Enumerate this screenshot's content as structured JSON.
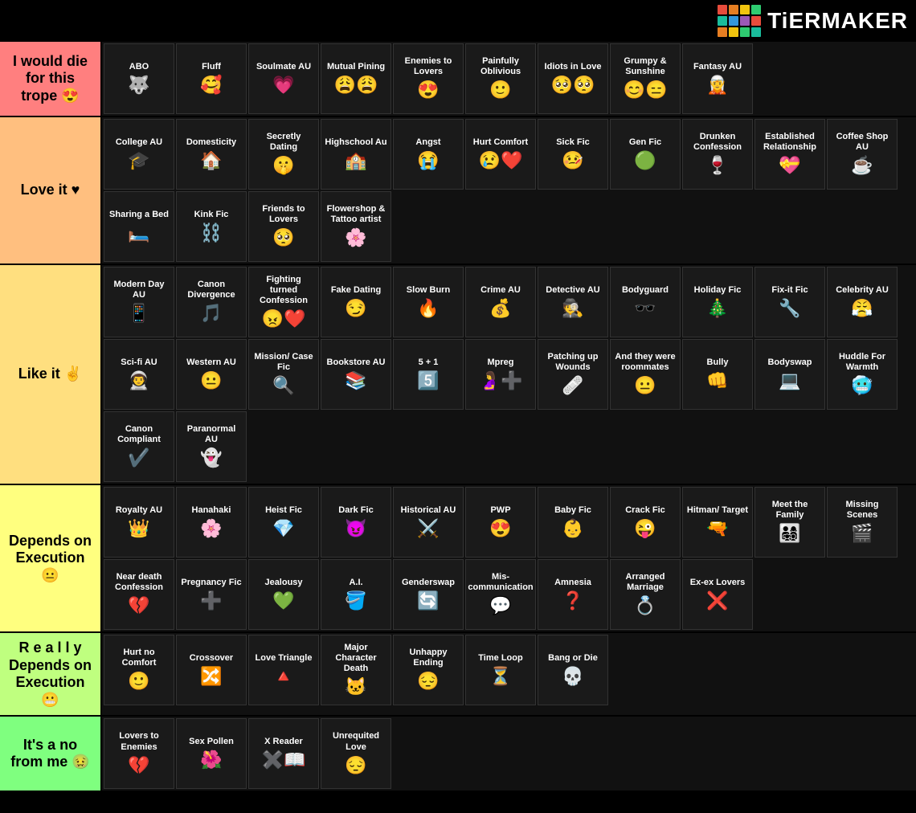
{
  "logo": {
    "colors": [
      "#e74c3c",
      "#e67e22",
      "#f1c40f",
      "#2ecc71",
      "#1abc9c",
      "#3498db",
      "#9b59b6",
      "#e74c3c",
      "#e67e22",
      "#f1c40f",
      "#2ecc71",
      "#1abc9c"
    ],
    "text": "TiERMAKER"
  },
  "tiers": [
    {
      "id": "s",
      "label": "I would die for this trope 😍",
      "color": "#ff7f7f",
      "cards": [
        {
          "title": "ABO",
          "emoji": "🐺"
        },
        {
          "title": "Fluff",
          "emoji": "🥰"
        },
        {
          "title": "Soulmate AU",
          "emoji": "💗"
        },
        {
          "title": "Mutual Pining",
          "emoji": "😩😩"
        },
        {
          "title": "Enemies to Lovers",
          "emoji": "😍"
        },
        {
          "title": "Painfully Oblivious",
          "emoji": "🙂"
        },
        {
          "title": "Idiots in Love",
          "emoji": "🥺🥺"
        },
        {
          "title": "Grumpy & Sunshine",
          "emoji": "😊😑"
        },
        {
          "title": "Fantasy AU",
          "emoji": "🧝"
        }
      ]
    },
    {
      "id": "a",
      "label": "Love it ♥",
      "color": "#ffbf7f",
      "cards": [
        {
          "title": "College AU",
          "emoji": "🎓"
        },
        {
          "title": "Domesticity",
          "emoji": "🏠"
        },
        {
          "title": "Secretly Dating",
          "emoji": "🤫"
        },
        {
          "title": "Highschool Au",
          "emoji": "🏫"
        },
        {
          "title": "Angst",
          "emoji": "😭"
        },
        {
          "title": "Hurt Comfort",
          "emoji": "😢❤️"
        },
        {
          "title": "Sick Fic",
          "emoji": "🤒"
        },
        {
          "title": "Gen Fic",
          "emoji": "🟢"
        },
        {
          "title": "Drunken Confession",
          "emoji": "🍷"
        },
        {
          "title": "Established Relationship",
          "emoji": "💝"
        },
        {
          "title": "Coffee Shop AU",
          "emoji": "☕"
        },
        {
          "title": "Sharing a Bed",
          "emoji": "🛏️"
        },
        {
          "title": "Kink Fic",
          "emoji": "⛓️"
        },
        {
          "title": "Friends to Lovers",
          "emoji": "🥺"
        },
        {
          "title": "Flowershop & Tattoo artist",
          "emoji": "🌸"
        }
      ]
    },
    {
      "id": "b",
      "label": "Like it ✌",
      "color": "#ffdf7f",
      "cards": [
        {
          "title": "Modern Day AU",
          "emoji": "📱"
        },
        {
          "title": "Canon Divergence",
          "emoji": "🎵"
        },
        {
          "title": "Fighting turned Confession",
          "emoji": "😠❤️"
        },
        {
          "title": "Fake Dating",
          "emoji": "😏"
        },
        {
          "title": "Slow Burn",
          "emoji": "🔥"
        },
        {
          "title": "Crime AU",
          "emoji": "💰"
        },
        {
          "title": "Detective AU",
          "emoji": "🕵️"
        },
        {
          "title": "Bodyguard",
          "emoji": "🕶️"
        },
        {
          "title": "Holiday Fic",
          "emoji": "🎄"
        },
        {
          "title": "Fix-it Fic",
          "emoji": "🔧"
        },
        {
          "title": "Celebrity AU",
          "emoji": "😤"
        },
        {
          "title": "Sci-fi AU",
          "emoji": "👨‍🚀"
        },
        {
          "title": "Western AU",
          "emoji": "😐"
        },
        {
          "title": "Mission/ Case Fic",
          "emoji": "🔍"
        },
        {
          "title": "Bookstore AU",
          "emoji": "📚"
        },
        {
          "title": "5 + 1",
          "emoji": "5️⃣"
        },
        {
          "title": "Mpreg",
          "emoji": "🤰➕"
        },
        {
          "title": "Patching up Wounds",
          "emoji": "🩹"
        },
        {
          "title": "And they were roommates",
          "emoji": "😐"
        },
        {
          "title": "Bully",
          "emoji": "👊"
        },
        {
          "title": "Bodyswap",
          "emoji": "💻"
        },
        {
          "title": "Huddle For Warmth",
          "emoji": "🥶"
        },
        {
          "title": "Canon Compliant",
          "emoji": "✔️"
        },
        {
          "title": "Paranormal AU",
          "emoji": "👻"
        }
      ]
    },
    {
      "id": "c",
      "label": "Depends on Execution 😐",
      "color": "#ffff7f",
      "cards": [
        {
          "title": "Royalty AU",
          "emoji": "👑"
        },
        {
          "title": "Hanahaki",
          "emoji": "🌸"
        },
        {
          "title": "Heist Fic",
          "emoji": "💎"
        },
        {
          "title": "Dark Fic",
          "emoji": "😈"
        },
        {
          "title": "Historical AU",
          "emoji": "⚔️"
        },
        {
          "title": "PWP",
          "emoji": "😍"
        },
        {
          "title": "Baby Fic",
          "emoji": "👶"
        },
        {
          "title": "Crack Fic",
          "emoji": "😜"
        },
        {
          "title": "Hitman/ Target",
          "emoji": "🔫"
        },
        {
          "title": "Meet the Family",
          "emoji": "👨‍👩‍👧‍👦"
        },
        {
          "title": "Missing Scenes",
          "emoji": "🎬"
        },
        {
          "title": "Near death Confession",
          "emoji": "💔"
        },
        {
          "title": "Pregnancy Fic",
          "emoji": "➕"
        },
        {
          "title": "Jealousy",
          "emoji": "💚"
        },
        {
          "title": "A.I.",
          "emoji": "🪣"
        },
        {
          "title": "Genderswap",
          "emoji": "🔄"
        },
        {
          "title": "Mis-communication",
          "emoji": "💬"
        },
        {
          "title": "Amnesia",
          "emoji": "❓"
        },
        {
          "title": "Arranged Marriage",
          "emoji": "💍"
        },
        {
          "title": "Ex-ex Lovers",
          "emoji": "❌"
        }
      ]
    },
    {
      "id": "d",
      "label": "R e a l l y Depends on Execution 😬",
      "color": "#bfff7f",
      "cards": [
        {
          "title": "Hurt no Comfort",
          "emoji": "🙂"
        },
        {
          "title": "Crossover",
          "emoji": "🔀"
        },
        {
          "title": "Love Triangle",
          "emoji": "🔺"
        },
        {
          "title": "Major Character Death",
          "emoji": "🐱"
        },
        {
          "title": "Unhappy Ending",
          "emoji": "😔"
        },
        {
          "title": "Time Loop",
          "emoji": "⏳"
        },
        {
          "title": "Bang or Die",
          "emoji": "💀"
        }
      ]
    },
    {
      "id": "f",
      "label": "It's a no from me 🤢",
      "color": "#7fff7f",
      "cards": [
        {
          "title": "Lovers to Enemies",
          "emoji": "💔"
        },
        {
          "title": "Sex Pollen",
          "emoji": "🌺"
        },
        {
          "title": "X Reader",
          "emoji": "✖️📖"
        },
        {
          "title": "Unrequited Love",
          "emoji": "😔"
        }
      ]
    }
  ]
}
